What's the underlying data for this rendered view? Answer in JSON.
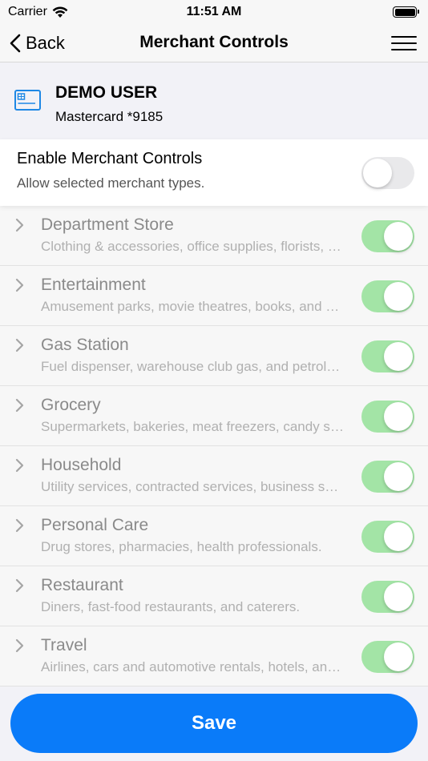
{
  "status_bar": {
    "carrier": "Carrier",
    "time": "11:51 AM"
  },
  "nav": {
    "back_label": "Back",
    "title": "Merchant Controls"
  },
  "card": {
    "holder": "DEMO USER",
    "number": "Mastercard *9185"
  },
  "enable": {
    "title": "Enable Merchant Controls",
    "subtitle": "Allow selected merchant types.",
    "enabled": false
  },
  "merchants": [
    {
      "title": "Department Store",
      "description": "Clothing & accessories, office supplies, florists, and more.",
      "enabled": true
    },
    {
      "title": "Entertainment",
      "description": "Amusement parks, movie theatres, books, and more.",
      "enabled": true
    },
    {
      "title": "Gas Station",
      "description": "Fuel dispenser, warehouse club gas, and petroleum.",
      "enabled": true
    },
    {
      "title": "Grocery",
      "description": "Supermarkets, bakeries, meat freezers, candy stores.",
      "enabled": true
    },
    {
      "title": "Household",
      "description": "Utility services, contracted services, business services.",
      "enabled": true
    },
    {
      "title": "Personal Care",
      "description": "Drug stores, pharmacies, health professionals.",
      "enabled": true
    },
    {
      "title": "Restaurant",
      "description": "Diners, fast-food restaurants, and caterers.",
      "enabled": true
    },
    {
      "title": "Travel",
      "description": "Airlines, cars and automotive rentals, hotels, and more.",
      "enabled": true
    }
  ],
  "save_label": "Save",
  "colors": {
    "accent": "#0a7bf9",
    "toggle_on": "#a3e4a6",
    "toggle_off": "#e9e9eb"
  },
  "icons": {
    "back": "chevron-left-icon",
    "menu": "hamburger-menu-icon",
    "card": "credit-card-icon",
    "row": "chevron-right-icon",
    "wifi": "wifi-icon",
    "battery": "battery-icon"
  }
}
